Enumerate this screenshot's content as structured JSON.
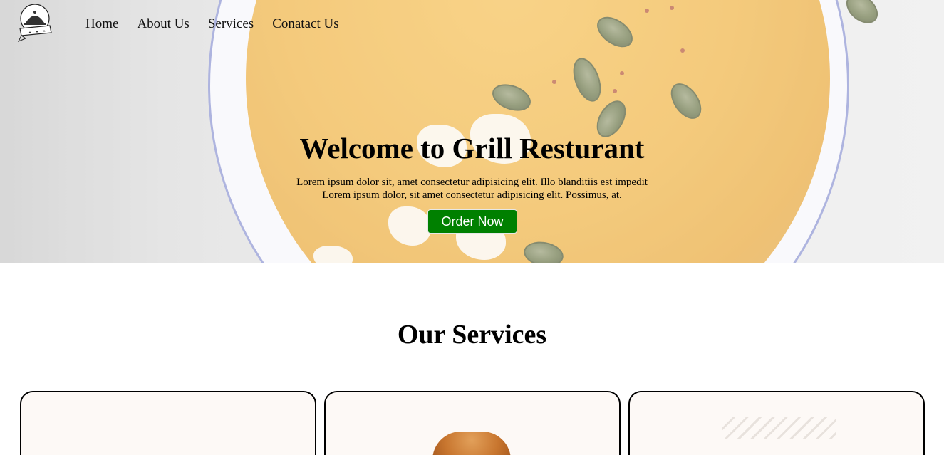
{
  "nav": {
    "logo_alt": "GRILL",
    "items": [
      {
        "label": "Home"
      },
      {
        "label": "About Us"
      },
      {
        "label": "Services"
      },
      {
        "label": "Conatact Us"
      }
    ]
  },
  "hero": {
    "title": "Welcome to Grill Resturant",
    "line1": "Lorem ipsum dolor sit, amet consectetur adipisicing elit. Illo blanditiis est impedit",
    "line2": "Lorem ipsum dolor, sit amet consectetur adipisicing elit. Possimus, at.",
    "button_label": "Order Now",
    "button_color": "#008000"
  },
  "services": {
    "title": "Our Services"
  }
}
